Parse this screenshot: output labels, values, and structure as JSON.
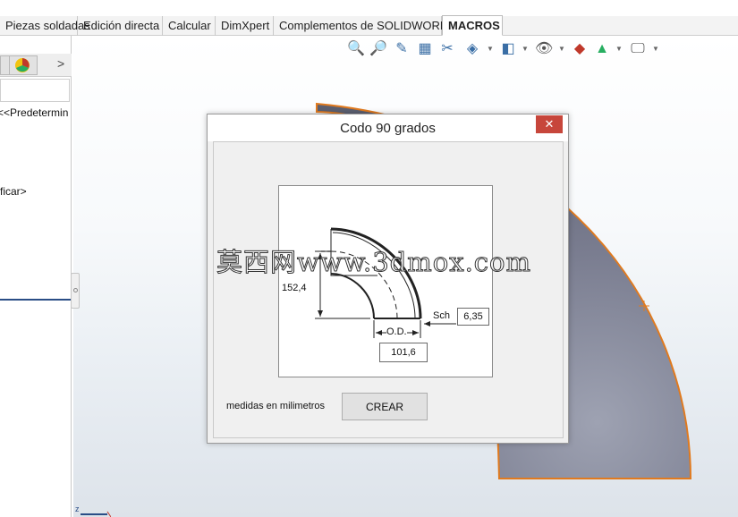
{
  "tabs": [
    {
      "label": "Piezas soldadas",
      "active": false
    },
    {
      "label": "Edición directa",
      "active": false
    },
    {
      "label": "Calcular",
      "active": false
    },
    {
      "label": "DimXpert",
      "active": false
    },
    {
      "label": "Complementos de SOLIDWORKS",
      "active": false
    },
    {
      "label": "MACROS",
      "active": true
    }
  ],
  "left_panel": {
    "chevron": ">",
    "config_text": "<<Predetermin",
    "edit_text": "ficar>"
  },
  "view_toolbar": {
    "icons": [
      "zoom-to-fit-icon",
      "zoom-to-area-icon",
      "previous-view-icon",
      "section-view-icon",
      "dynamic-annotation-icon",
      "view-orientation-icon",
      "display-style-icon",
      "hide-show-icon",
      "edit-appearance-icon",
      "apply-scene-icon",
      "view-settings-icon"
    ]
  },
  "dialog": {
    "title": "Codo 90 grados",
    "close": "✕",
    "drawing": {
      "height_value": "152,4",
      "sch_label": "Sch",
      "sch_value": "6,35",
      "od_label": "O.D.",
      "od_value": "101,6"
    },
    "units_label": "medidas en milimetros",
    "create_button": "CREAR"
  },
  "watermark": "莫西网www.3dmox.com",
  "triad": "z",
  "colors": {
    "close_button": "#c7463b",
    "model_edge": "#e07a1f",
    "model_face": "#7a7d90",
    "panel_line": "#2a4d86"
  }
}
